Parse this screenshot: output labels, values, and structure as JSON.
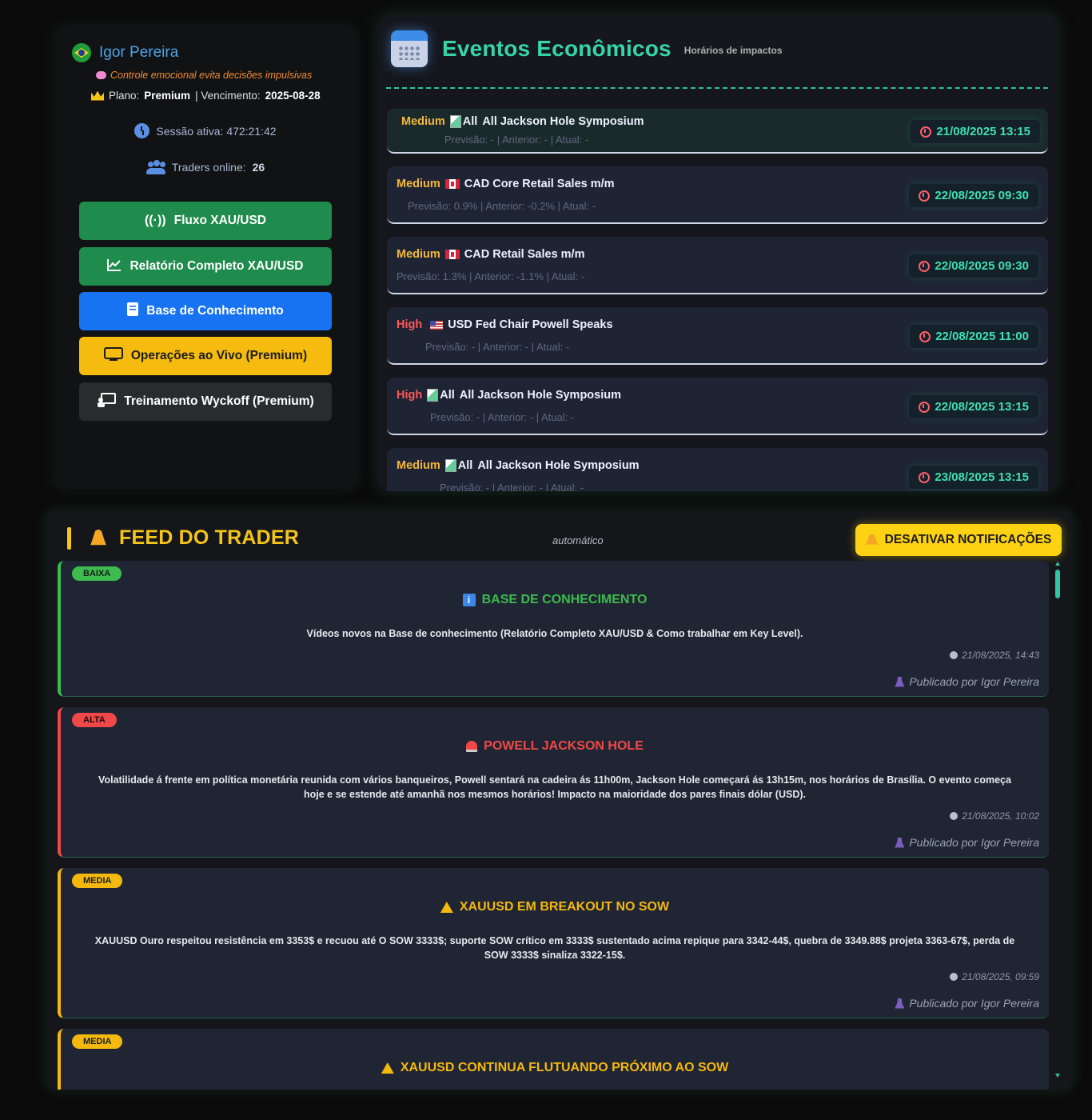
{
  "profile": {
    "name": "Igor Pereira",
    "tip": "Controle emocional evita decisões impulsivas",
    "plan_label": "Plano:",
    "plan_value": "Premium",
    "expiry_label": "| Vencimento:",
    "expiry_value": "2025-08-28",
    "session_text": "Sessão ativa: 472:21:42",
    "online_label": "Traders online:",
    "online_value": "26",
    "buttons": [
      {
        "label": "Fluxo XAU/USD",
        "icon": "broadcast-icon"
      },
      {
        "label": "Relatório Completo XAU/USD",
        "icon": "chart-line-icon"
      },
      {
        "label": "Base de Conhecimento",
        "icon": "book-icon"
      },
      {
        "label": "Operações ao Vivo (Premium)",
        "icon": "monitor-icon"
      },
      {
        "label": "Treinamento Wyckoff (Premium)",
        "icon": "teacher-icon"
      }
    ]
  },
  "events": {
    "title": "Eventos Econômicos",
    "subtitle": "Horários de impactos",
    "items": [
      {
        "impact": "Medium",
        "flag": "broken-image",
        "alt": "All",
        "name": "All Jackson Hole Symposium",
        "details": "Previsão: - | Anterior: - | Atual: -",
        "time": "21/08/2025 13:15"
      },
      {
        "impact": "Medium",
        "flag": "canada-flag",
        "alt": "",
        "name": "CAD Core Retail Sales m/m",
        "details": "Previsão: 0.9% | Anterior: -0.2% | Atual: -",
        "time": "22/08/2025 09:30"
      },
      {
        "impact": "Medium",
        "flag": "canada-flag",
        "alt": "",
        "name": "CAD Retail Sales m/m",
        "details": "Previsão: 1.3% | Anterior: -1.1% | Atual: -",
        "time": "22/08/2025 09:30"
      },
      {
        "impact": "High",
        "flag": "usa-flag",
        "alt": "",
        "name": "USD Fed Chair Powell Speaks",
        "details": "Previsão: - | Anterior: - | Atual: -",
        "time": "22/08/2025 11:00"
      },
      {
        "impact": "High",
        "flag": "broken-image",
        "alt": "All",
        "name": "All Jackson Hole Symposium",
        "details": "Previsão: - | Anterior: - | Atual: -",
        "time": "22/08/2025 13:15"
      },
      {
        "impact": "Medium",
        "flag": "broken-image",
        "alt": "All",
        "name": "All Jackson Hole Symposium",
        "details": "Previsão: - | Anterior: - | Atual: -",
        "time": "23/08/2025 13:15"
      }
    ]
  },
  "feed": {
    "title": "FEED DO TRADER",
    "mode": "automático",
    "toggle_label": "DESATIVAR NOTIFICAÇÕES",
    "posts": [
      {
        "level": "BAIXA",
        "title": "BASE DE CONHECIMENTO",
        "body": "Vídeos novos na Base de conhecimento (Relatório Completo XAU/USD & Como trabalhar em Key Level).",
        "time": "21/08/2025, 14:43",
        "author": "Publicado por Igor Pereira"
      },
      {
        "level": "ALTA",
        "title": "POWELL JACKSON HOLE",
        "body": "Volatilidade á frente em política monetária reunida com vários banqueiros, Powell sentará na cadeira ás 11h00m, Jackson Hole começará ás 13h15m, nos horários de Brasília. O evento começa hoje e se estende até amanhã nos mesmos horários! Impacto na maioridade dos pares finais dólar (USD).",
        "time": "21/08/2025, 10:02",
        "author": "Publicado por Igor Pereira"
      },
      {
        "level": "MEDIA",
        "title": "XAUUSD EM BREAKOUT NO SOW",
        "body": "XAUUSD Ouro respeitou resistência em 3353$ e recuou até O SOW 3333$; suporte SOW crítico em 3333$ sustentado acima repique para 3342-44$, quebra de 3349.88$ projeta 3363-67$, perda de SOW 3333$ sinaliza 3322-15$.",
        "time": "21/08/2025, 09:59",
        "author": "Publicado por Igor Pereira"
      },
      {
        "level": "MEDIA",
        "title": "XAUUSD CONTINUA FLUTUANDO PRÓXIMO AO SOW"
      }
    ]
  },
  "colors": {
    "accent_teal": "#36d5a8",
    "feed_yellow": "#f5c518",
    "low": "#3dbb4f",
    "high": "#f04848",
    "medium": "#f5b80f"
  }
}
